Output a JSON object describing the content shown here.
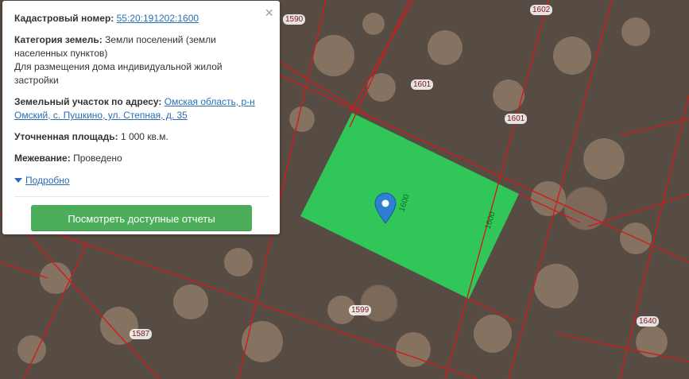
{
  "map": {
    "parcel_labels": [
      {
        "id": "1590",
        "text": "1590"
      },
      {
        "id": "1602",
        "text": "1602"
      },
      {
        "id": "1601a",
        "text": "1601"
      },
      {
        "id": "1601b",
        "text": "1601"
      },
      {
        "id": "1599",
        "text": "1599"
      },
      {
        "id": "1587",
        "text": "1587"
      },
      {
        "id": "1640",
        "text": "1640"
      },
      {
        "id": "1600a",
        "text": "1600"
      },
      {
        "id": "1600b",
        "text": "1600"
      }
    ],
    "highlight_color": "#2ed15a",
    "boundary_color": "#d11b1b",
    "marker_color": "#2f7fd1"
  },
  "popup": {
    "cadastral_label": "Кадастровый номер:",
    "cadastral_value": "55:20:191202:1600",
    "category_label": "Категория земель:",
    "category_value": "Земли поселений (земли населенных пунктов)",
    "category_use": "Для размещения дома индивидуальной жилой застройки",
    "address_label": "Земельный участок по адресу:",
    "address_value": "Омская область, р-н Омский, с. Пушкино, ул. Степная, д. 35",
    "area_label": "Уточненная площадь:",
    "area_value": "1 000 кв.м.",
    "survey_label": "Межевание:",
    "survey_value": "Проведено",
    "details_link": "Подробно",
    "report_button": "Посмотреть доступные отчеты",
    "close_symbol": "×",
    "button_color": "#4cae5a"
  }
}
